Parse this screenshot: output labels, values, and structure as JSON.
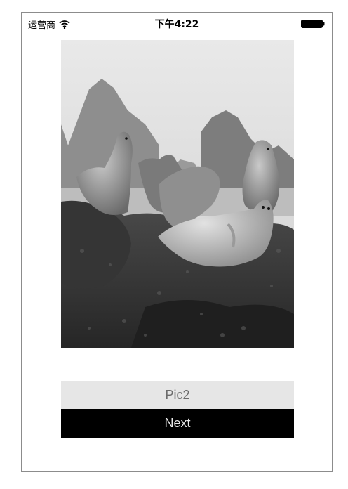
{
  "status_bar": {
    "carrier": "运营商",
    "time": "下午4:22",
    "wifi_icon": "wifi-icon",
    "battery_icon": "battery-icon"
  },
  "photo": {
    "description_icon": "seals-photo"
  },
  "label": {
    "text": "Pic2"
  },
  "next_button": {
    "label": "Next"
  },
  "colors": {
    "label_bg": "#e6e6e6",
    "label_text": "#6b6b6b",
    "button_bg": "#000000",
    "button_text": "#e8e8e8"
  }
}
